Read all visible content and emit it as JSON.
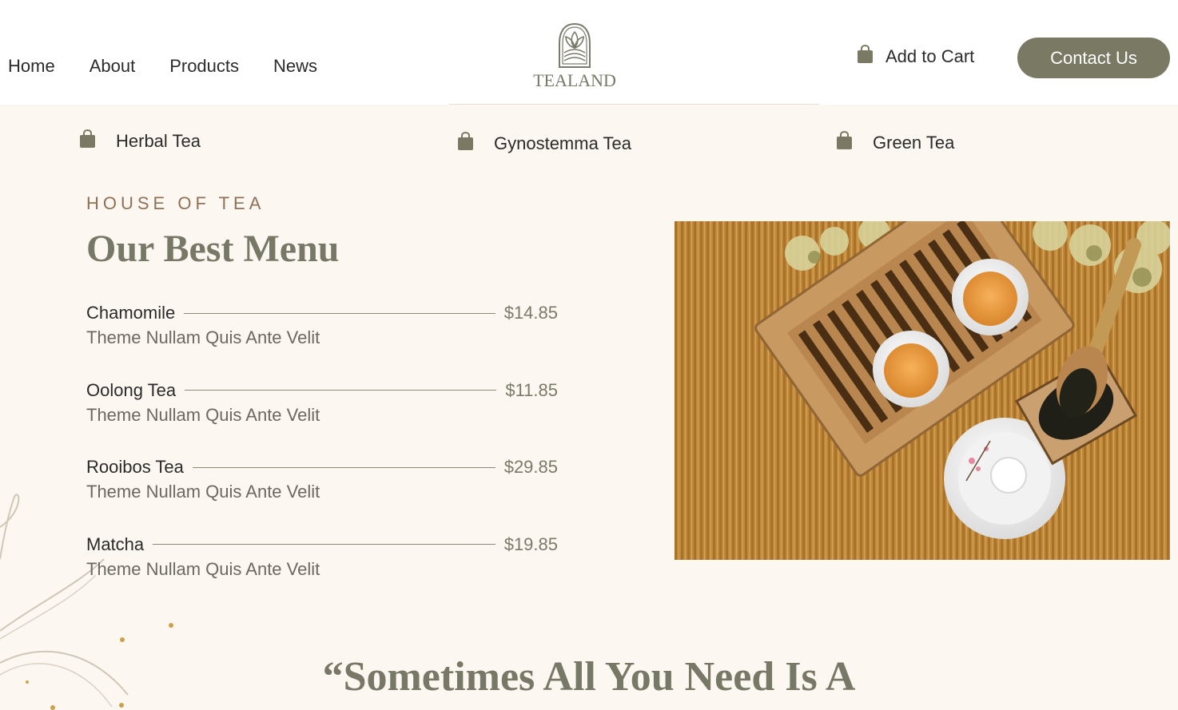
{
  "header": {
    "nav": [
      "Home",
      "About",
      "Products",
      "News"
    ],
    "logo_text": "TEALAND",
    "cart_label": "Add to Cart",
    "contact_label": "Contact Us"
  },
  "categories": [
    {
      "label": "Herbal Tea",
      "icon": "shopping-bag-icon"
    },
    {
      "label": "Gynostemma Tea",
      "icon": "shopping-bag-icon"
    },
    {
      "label": "Green Tea",
      "icon": "shopping-bag-icon"
    }
  ],
  "section": {
    "eyebrow": "HOUSE OF TEA",
    "title": "Our Best Menu"
  },
  "menu": [
    {
      "name": "Chamomile",
      "price": "$14.85",
      "desc": "Theme Nullam Quis Ante Velit"
    },
    {
      "name": "Oolong Tea",
      "price": "$11.85",
      "desc": "Theme Nullam Quis Ante Velit"
    },
    {
      "name": "Rooibos Tea",
      "price": "$29.85",
      "desc": "Theme Nullam Quis Ante Velit"
    },
    {
      "name": "Matcha",
      "price": "$19.85",
      "desc": "Theme Nullam Quis Ante Velit"
    }
  ],
  "quote": "“Sometimes All You Need Is A",
  "colors": {
    "background": "#fcf7f1",
    "accent": "#7a7a64",
    "eyebrow": "#8f7156"
  }
}
